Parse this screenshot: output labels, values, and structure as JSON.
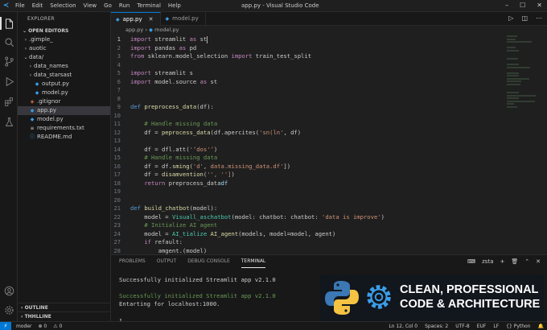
{
  "window": {
    "title": "app.py - Visual Studio Code",
    "menu": [
      "File",
      "Edit",
      "Selection",
      "View",
      "Go",
      "Run",
      "Terminal",
      "Help"
    ]
  },
  "sidebar": {
    "header": "EXPLORER",
    "open_editors": "OPEN EDITORS",
    "items": [
      {
        "label": ".gimple_",
        "indent": 1,
        "kind": "folder",
        "chev": "›"
      },
      {
        "label": "auotic",
        "indent": 1,
        "kind": "folder",
        "chev": "›"
      },
      {
        "label": "data/",
        "indent": 1,
        "kind": "folder",
        "chev": "⌄"
      },
      {
        "label": "data_names",
        "indent": 2,
        "kind": "folder",
        "chev": "›"
      },
      {
        "label": "data_starsast",
        "indent": 2,
        "kind": "folder",
        "chev": "›"
      },
      {
        "label": "output.py",
        "indent": 2,
        "kind": "py",
        "chev": ""
      },
      {
        "label": "model.py",
        "indent": 2,
        "kind": "py",
        "chev": ""
      },
      {
        "label": ".gitignor",
        "indent": 1,
        "kind": "git",
        "chev": ""
      },
      {
        "label": "app.py",
        "indent": 1,
        "kind": "py",
        "chev": "",
        "selected": true
      },
      {
        "label": "model.py",
        "indent": 1,
        "kind": "py",
        "chev": ""
      },
      {
        "label": "requirements.txt",
        "indent": 1,
        "kind": "txt",
        "chev": ""
      },
      {
        "label": "README.md",
        "indent": 1,
        "kind": "md",
        "chev": ""
      }
    ],
    "outline": "OUTLINE",
    "timeline": "THHLLINE"
  },
  "tabs": [
    {
      "label": "app.py",
      "active": true
    },
    {
      "label": "model.py",
      "active": false
    }
  ],
  "breadcrumb": [
    "app.py",
    "model.py"
  ],
  "code": [
    {
      "n": "1",
      "t": [
        [
          "k",
          "import "
        ],
        [
          "src",
          "streamlit "
        ],
        [
          "k",
          "as "
        ],
        [
          "src",
          "st"
        ]
      ]
    },
    {
      "n": "2",
      "t": [
        [
          "k",
          "import "
        ],
        [
          "src",
          "pandas "
        ],
        [
          "k",
          "as "
        ],
        [
          "src",
          "pd"
        ]
      ]
    },
    {
      "n": "3",
      "t": [
        [
          "k",
          "from "
        ],
        [
          "src",
          "sklearn.model_selection "
        ],
        [
          "k",
          "import "
        ],
        [
          "src",
          "train_test_split"
        ]
      ]
    },
    {
      "n": "4",
      "t": []
    },
    {
      "n": "5",
      "t": [
        [
          "k",
          "import "
        ],
        [
          "src",
          "streamlit s"
        ]
      ]
    },
    {
      "n": "6",
      "t": [
        [
          "k",
          "import "
        ],
        [
          "src",
          "model.source "
        ],
        [
          "k",
          "as "
        ],
        [
          "src",
          "st"
        ]
      ]
    },
    {
      "n": "7",
      "t": []
    },
    {
      "n": "8",
      "t": []
    },
    {
      "n": "9",
      "t": [
        [
          "kd",
          "def "
        ],
        [
          "fn",
          "preprocess_data"
        ],
        [
          "src",
          "(df):"
        ]
      ]
    },
    {
      "n": "10",
      "t": []
    },
    {
      "n": "11",
      "t": [
        [
          "src",
          "    "
        ],
        [
          "c",
          "# Handle missing data"
        ]
      ]
    },
    {
      "n": "12",
      "t": [
        [
          "src",
          "    df = "
        ],
        [
          "fn",
          "peprocess_data"
        ],
        [
          "src",
          "(df.apercites("
        ],
        [
          "s",
          "'sn(ln'"
        ],
        [
          "src",
          ", df)"
        ]
      ]
    },
    {
      "n": "13",
      "t": []
    },
    {
      "n": "14",
      "t": [
        [
          "src",
          "    df = dfl.att("
        ],
        [
          "s",
          "'‘dos'’"
        ],
        [
          "src",
          ")"
        ]
      ]
    },
    {
      "n": "15",
      "t": [
        [
          "src",
          "    "
        ],
        [
          "c",
          "# Handle missing data"
        ]
      ]
    },
    {
      "n": "16",
      "t": [
        [
          "src",
          "    df = df."
        ],
        [
          "fn",
          "sming"
        ],
        [
          "src",
          "("
        ],
        [
          "s",
          "'d'"
        ],
        [
          "src",
          ", "
        ],
        [
          "s",
          "data.missing_data.df'"
        ],
        [
          "src",
          "])"
        ]
      ]
    },
    {
      "n": "17",
      "t": [
        [
          "src",
          "    df = "
        ],
        [
          "fn",
          "disamvention"
        ],
        [
          "src",
          "("
        ],
        [
          "s",
          "'', '']"
        ],
        [
          "src",
          ")"
        ]
      ]
    },
    {
      "n": "18",
      "t": [
        [
          "src",
          "    "
        ],
        [
          "k",
          "return "
        ],
        [
          "src",
          "preprocess_data"
        ],
        [
          "v",
          "df"
        ]
      ]
    },
    {
      "n": "19",
      "t": []
    },
    {
      "n": "20",
      "t": []
    },
    {
      "n": "21",
      "t": [
        [
          "kd",
          "def "
        ],
        [
          "fn",
          "build_chatbot"
        ],
        [
          "src",
          "(model):"
        ]
      ]
    },
    {
      "n": "22",
      "t": [
        [
          "src",
          "    model = "
        ],
        [
          "cls",
          "Visuall_aschatbot"
        ],
        [
          "src",
          "(model: chatbot: chatbot: "
        ],
        [
          "s",
          "'data is improve'"
        ],
        [
          "src",
          ")"
        ]
      ]
    },
    {
      "n": "23",
      "t": [
        [
          "src",
          "    "
        ],
        [
          "c",
          "# Initialize AI agent"
        ]
      ]
    },
    {
      "n": "24",
      "t": [
        [
          "src",
          "    model = "
        ],
        [
          "cls",
          "AI_tialize "
        ],
        [
          "fn",
          "AI_agent"
        ],
        [
          "src",
          "(models, model=model, agent)"
        ]
      ]
    },
    {
      "n": "27",
      "t": [
        [
          "src",
          "    "
        ],
        [
          "k",
          "if "
        ],
        [
          "src",
          "refault:"
        ]
      ]
    },
    {
      "n": "28",
      "t": [
        [
          "src",
          "        amgent.(model)"
        ]
      ]
    }
  ],
  "panel": {
    "tabs": [
      "PROBLEMS",
      "OUTPUT",
      "DEBUG CONSOLE",
      "TERMINAL"
    ],
    "active_tab": "TERMINAL",
    "shell": "zsta",
    "terminal_lines": [
      {
        "text": "",
        "color": "#cccccc"
      },
      {
        "text": "Successfully initialized Streamlit app v2.1.0",
        "color": "#cccccc"
      },
      {
        "text": "",
        "color": "#cccccc"
      },
      {
        "text": "Successfully initialized Streamlit app v2.1.0",
        "color": "#6a9955"
      },
      {
        "text": "Entarting for localhost:1000.",
        "color": "#cccccc"
      },
      {
        "text": "",
        "color": "#cccccc"
      },
      {
        "text": "▯",
        "color": "#cccccc"
      }
    ]
  },
  "banner": {
    "line1": "CLEAN, PROFESSIONAL",
    "line2": "CODE & ARCHITECTURE"
  },
  "statusbar": {
    "left": [
      "moder",
      "⊗ 0",
      "⚠ 0"
    ],
    "right": [
      "Ln 12, Col 0",
      "Spaces: 2",
      "UTF-8",
      "EUF",
      "LF",
      "{} Python",
      "🔔"
    ]
  },
  "colors": {
    "accent": "#0078d4",
    "python_blue": "#3b78b4",
    "python_yellow": "#f5c242",
    "gear": "#3b9ee8"
  }
}
